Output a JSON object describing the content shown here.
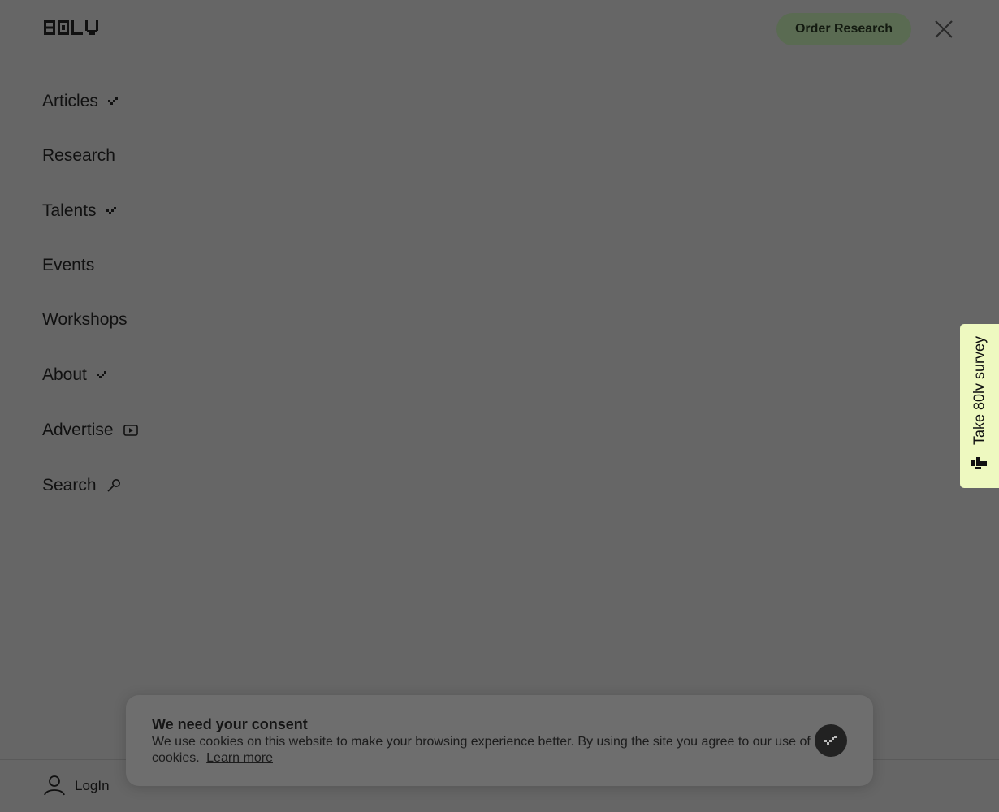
{
  "header": {
    "logo_text": "80LV",
    "order_label": "Order Research",
    "close_icon": "close-icon"
  },
  "nav": {
    "items": [
      {
        "label": "Articles",
        "icon": "pixel-arrow-icon"
      },
      {
        "label": "Research",
        "icon": ""
      },
      {
        "label": "Talents",
        "icon": "pixel-arrow-icon"
      },
      {
        "label": "Events",
        "icon": ""
      },
      {
        "label": "Workshops",
        "icon": ""
      },
      {
        "label": "About",
        "icon": "pixel-arrow-icon"
      },
      {
        "label": "Advertise",
        "icon": "play-icon"
      },
      {
        "label": "Search",
        "icon": "search-icon"
      }
    ]
  },
  "survey": {
    "label": "Take 80lv survey"
  },
  "footer": {
    "login_label": "LogIn"
  },
  "consent": {
    "title": "We need your consent",
    "text": "We use cookies on this website to make your browsing experience better. By using the site you agree to our use of cookies.",
    "link": "Learn more"
  },
  "colors": {
    "overlay": "#666666",
    "order_button": "#5a6b52",
    "survey_bg": "#eef9c0"
  }
}
